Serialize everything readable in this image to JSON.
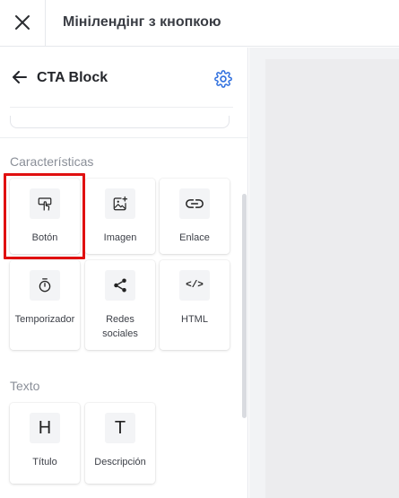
{
  "topbar": {
    "title": "Мінілендінг з кнопкою"
  },
  "panel": {
    "title": "CTA Block",
    "sections": [
      {
        "label": "Características"
      },
      {
        "label": "Texto"
      }
    ]
  },
  "tiles": {
    "boton": {
      "label": "Botón",
      "icon": "tap-icon"
    },
    "imagen": {
      "label": "Imagen",
      "icon": "image-add-icon"
    },
    "enlace": {
      "label": "Enlace",
      "icon": "link-icon"
    },
    "temporizador": {
      "label": "Temporizador",
      "icon": "stopwatch-icon"
    },
    "redes_line1": "Redes",
    "redes_line2": "sociales",
    "redes_icon": "share-icon",
    "html": {
      "label": "HTML",
      "glyph": "</>"
    },
    "titulo": {
      "label": "Título",
      "glyph": "H"
    },
    "descripcion": {
      "label": "Descripción",
      "glyph": "T"
    }
  },
  "colors": {
    "accent": "#2f6fde",
    "highlight": "#e01010"
  }
}
